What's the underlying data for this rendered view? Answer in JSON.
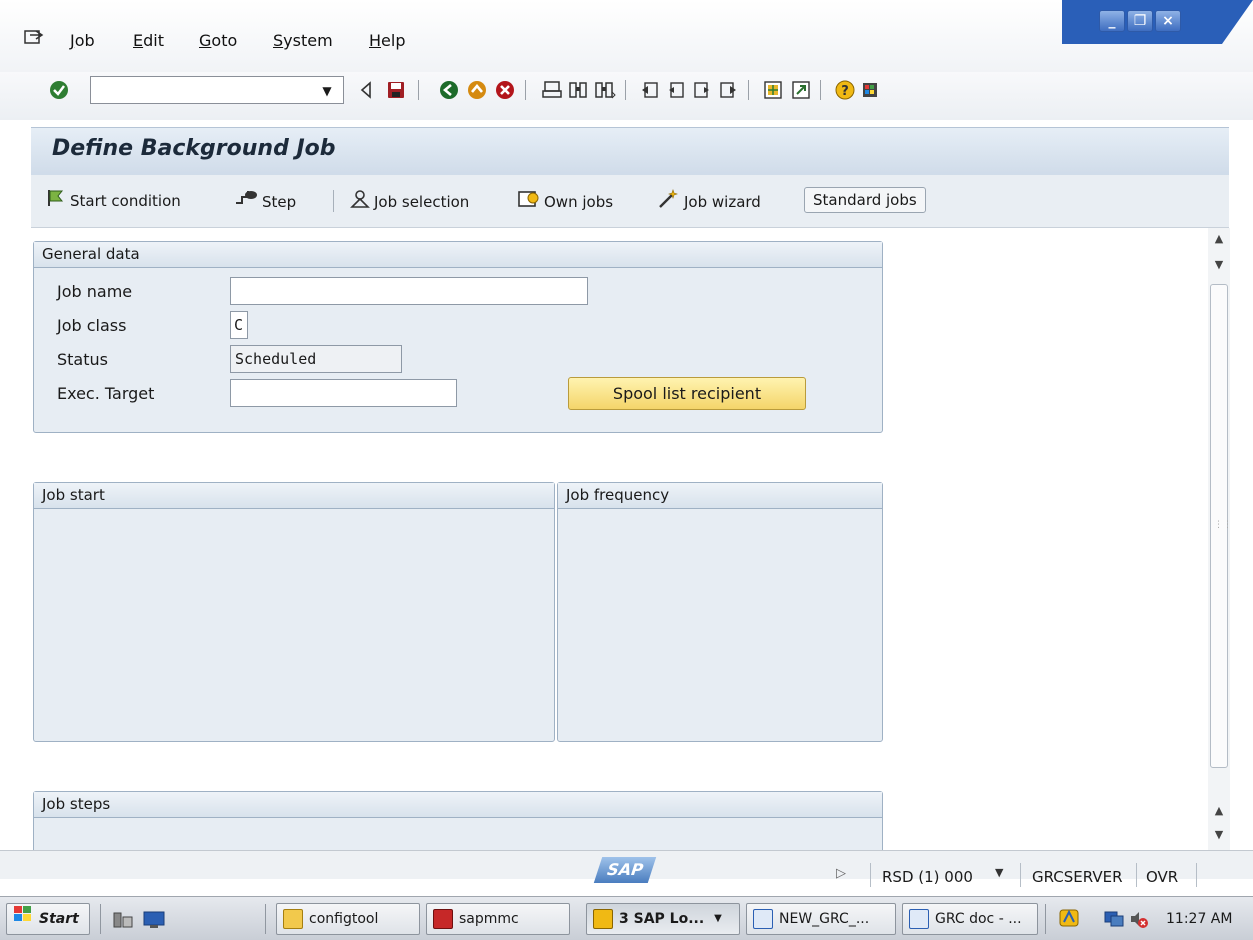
{
  "menu": {
    "items": [
      "Job",
      "Edit",
      "Goto",
      "System",
      "Help"
    ],
    "underline": [
      "J",
      "E",
      "G",
      "S",
      "H"
    ]
  },
  "window_controls": [
    "minimize",
    "restore",
    "close"
  ],
  "toolbar": {
    "command_field_value": "",
    "icons": [
      "enter-icon",
      "back-arrow-icon",
      "save-icon",
      "back-icon",
      "exit-icon",
      "cancel-icon",
      "print-icon",
      "find-icon",
      "find-next-icon",
      "first-page-icon",
      "previous-page-icon",
      "next-page-icon",
      "last-page-icon",
      "create-session-icon",
      "shortcut-icon",
      "help-icon",
      "customize-layout-icon"
    ]
  },
  "page": {
    "title": "Define Background Job"
  },
  "app_toolbar": {
    "start_condition": "Start condition",
    "step": "Step",
    "job_selection": "Job selection",
    "own_jobs": "Own jobs",
    "job_wizard": "Job wizard",
    "standard_jobs": "Standard jobs"
  },
  "general_data": {
    "header": "General data",
    "job_name_label": "Job name",
    "job_name_value": "",
    "job_class_label": "Job class",
    "job_class_value": "C",
    "status_label": "Status",
    "status_value": "Scheduled",
    "exec_target_label": "Exec. Target",
    "exec_target_value": "",
    "spool_button": "Spool list recipient"
  },
  "job_start": {
    "header": "Job start"
  },
  "job_frequency": {
    "header": "Job frequency"
  },
  "job_steps": {
    "header": "Job steps"
  },
  "status_bar": {
    "logo": "SAP",
    "system": "RSD (1) 000",
    "server": "GRCSERVER",
    "mode": "OVR"
  },
  "taskbar": {
    "start": "Start",
    "buttons": [
      "configtool",
      "sapmmc",
      "3 SAP Lo...",
      "NEW_GRC_...",
      "GRC doc - ..."
    ],
    "clock": "11:27 AM"
  },
  "colors": {
    "title_bar": "#cfdbe9",
    "group_bg": "#e7edf3",
    "spool_button": "#f4d56a",
    "window_control": "#3e6dc0"
  }
}
